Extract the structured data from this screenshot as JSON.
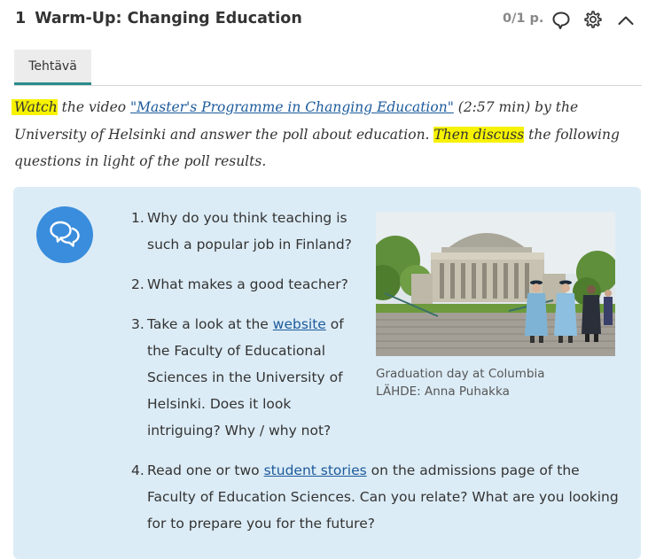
{
  "header": {
    "number": "1",
    "title": "Warm-Up: Changing Education",
    "score": "0/1 p.",
    "icons": [
      "speech-bubble-icon",
      "gear-icon",
      "chevron-up-icon"
    ]
  },
  "tabs": [
    {
      "label": "Tehtävä"
    }
  ],
  "intro": {
    "watch": "Watch",
    "t1": " the video ",
    "link": "\"Master's Programme in Changing Education\"",
    "t2": " (2:57 min) by the University of Helsinki and answer the poll about education. ",
    "then_discuss": "Then discuss",
    "t3": " the following questions in light of the poll results."
  },
  "questions": [
    {
      "num": "1.",
      "text": "Why do you think teaching is such a popular job in Finland?"
    },
    {
      "num": "2.",
      "text": " What makes a good teacher?"
    },
    {
      "num": "3.",
      "pre": "Take a look at the ",
      "link": "website",
      "post": " of the Faculty of Educational Sciences in the University of Helsinki. Does it look intriguing? Why / why not?"
    },
    {
      "num": "4.",
      "pre": "Read one or two ",
      "link": "student stories",
      "post": " on the admissions page of the Faculty of Education Sciences. Can you relate? What are you looking for to prepare you for the future?"
    }
  ],
  "image": {
    "caption": "Graduation day at Columbia",
    "source": "LÄHDE: Anna Puhakka"
  },
  "colors": {
    "accent": "#2a8c8c",
    "panel": "#dcecf6",
    "highlight": "#f6f200",
    "chat_circle": "#3a8ddc",
    "link": "#1c5a9c"
  }
}
